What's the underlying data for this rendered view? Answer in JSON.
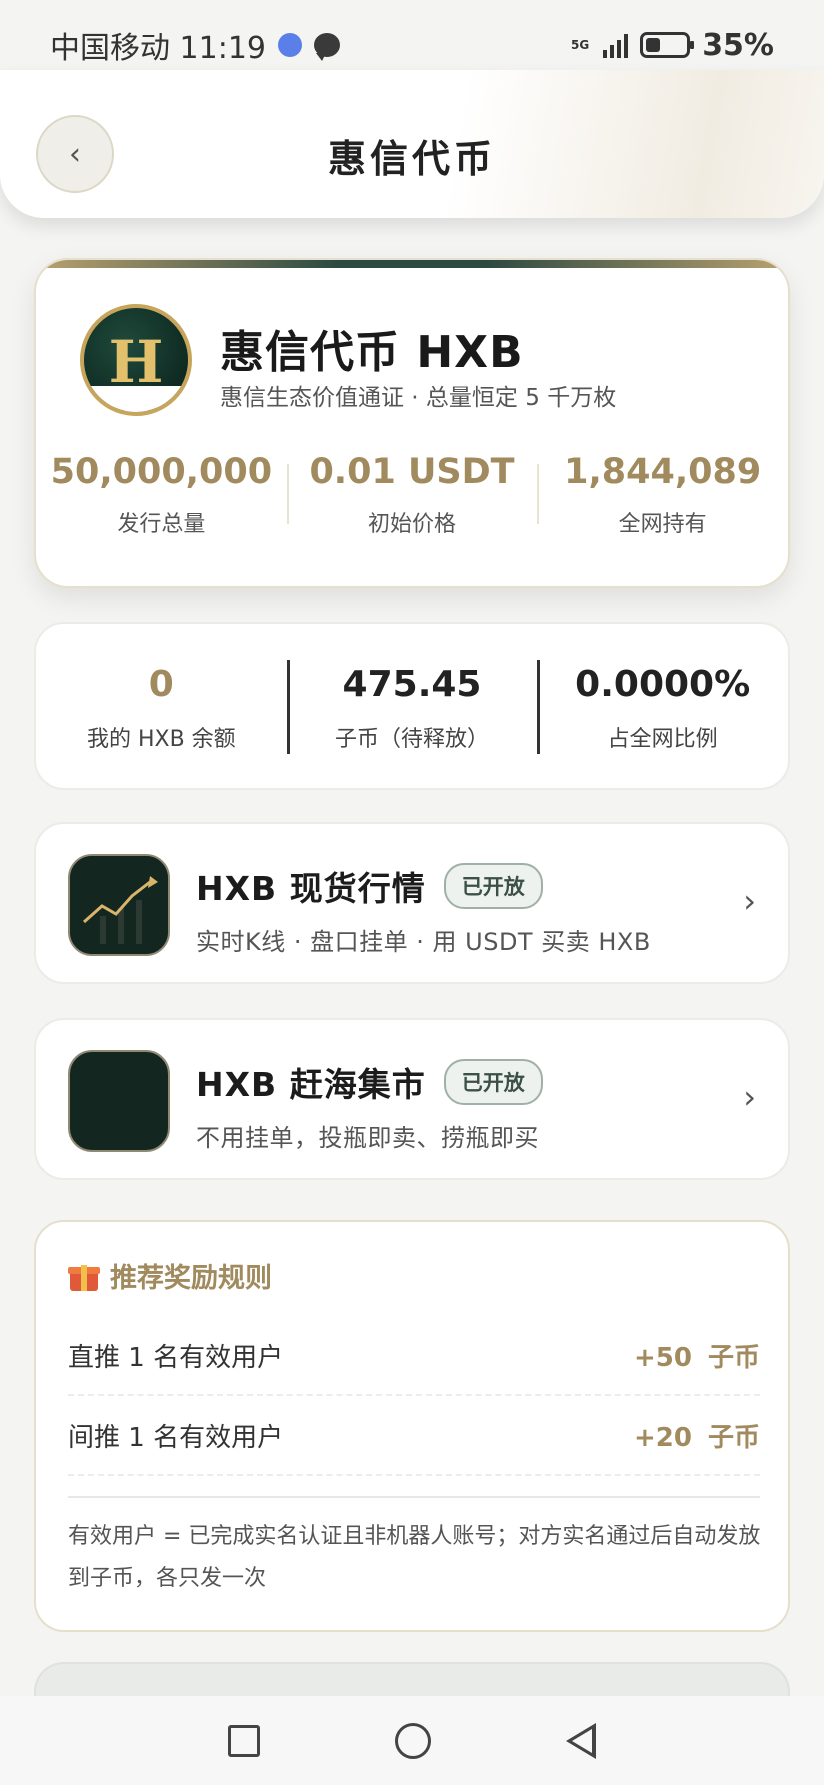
{
  "status_bar": {
    "carrier_time": "中国移动 11:19",
    "network": "5G",
    "battery": "35%"
  },
  "header": {
    "back_label": "‹",
    "title": "惠信代币"
  },
  "token": {
    "logo_letter": "H",
    "name": "惠信代币 HXB",
    "subtitle": "惠信生态价值通证 · 总量恒定 5 千万枚",
    "stats": [
      {
        "value": "50,000,000",
        "label": "发行总量"
      },
      {
        "value": "0.01 USDT",
        "label": "初始价格"
      },
      {
        "value": "1,844,089",
        "label": "全网持有"
      }
    ]
  },
  "balance": {
    "items": [
      {
        "value": "0",
        "label": "我的 HXB 余额"
      },
      {
        "value": "475.45",
        "label": "子币（待释放）"
      },
      {
        "value": "0.0000%",
        "label": "占全网比例"
      }
    ]
  },
  "features": [
    {
      "icon": "chart-up-icon",
      "title": "HXB 现货行情",
      "badge": "已开放",
      "desc": "实时K线 · 盘口挂单 · 用 USDT 买卖 HXB",
      "chevron": "›"
    },
    {
      "icon": "market-icon",
      "title": "HXB 赶海集市",
      "badge": "已开放",
      "desc": "不用挂单，投瓶即卖、捞瓶即买",
      "chevron": "›"
    }
  ],
  "rules": {
    "title": "推荐奖励规则",
    "rows": [
      {
        "label": "直推 1 名有效用户",
        "amount": "+50",
        "unit": "子币"
      },
      {
        "label": "间推 1 名有效用户",
        "amount": "+20",
        "unit": "子币"
      }
    ],
    "note": "有效用户 = 已完成实名认证且非机器人账号；对方实名通过后自动发放到子币，各只发一次"
  },
  "colors": {
    "gold": "#a08a5e",
    "dark_green": "#13261f",
    "badge_green": "#3b5048"
  }
}
